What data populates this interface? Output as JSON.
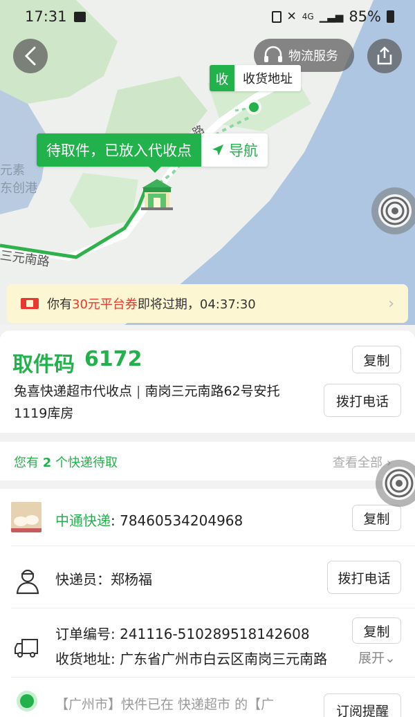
{
  "status_bar": {
    "time": "17:31",
    "network": "4G",
    "battery": "85%"
  },
  "map": {
    "service_button": "物流服务",
    "receive_tag": {
      "key": "收",
      "label": "收货地址"
    },
    "pickup_tag": {
      "status": "待取件，已放入代收点",
      "nav_label": "导航"
    },
    "labels": {
      "road_1": "三元南路",
      "road_2": "路",
      "place_1": "元素",
      "place_2": "东创港"
    }
  },
  "coupon": {
    "prefix": "你有",
    "amount": "30元平台券",
    "suffix": "即将过期，04:37:30"
  },
  "pickup": {
    "code_label": "取件码",
    "code": "6172",
    "station": "兔喜快递超市代收点",
    "separator": " | ",
    "address": "南岗三元南路62号安托1119库房",
    "copy_button": "复制",
    "call_button": "拨打电话"
  },
  "pending": {
    "prefix": "您有 ",
    "count": "2",
    "suffix": " 个快递待取",
    "view_all": "查看全部"
  },
  "package": {
    "courier_name": "中通快递",
    "tracking_label": ": ",
    "tracking_number": "78460534204968",
    "copy_button": "复制",
    "staff_label": "快递员：",
    "staff_name": "郑杨福",
    "call_button": "拨打电话",
    "order_label": "订单编号: ",
    "order_number": "241116-510289518142608",
    "order_copy_button": "复制",
    "address_label": "收货地址: ",
    "address_value": "广东省广州市白云区南岗三元南路",
    "expand_label": "展开",
    "tracking_text": "【广州市】快件已在 快递超市 的【广",
    "subscribe_button": "订阅提醒"
  },
  "colors": {
    "brand_green": "#22b24c",
    "coupon_red": "#e8382f",
    "coupon_bg": "#fdf6d2",
    "water": "#aec6e2",
    "park": "#cfe7c8"
  }
}
